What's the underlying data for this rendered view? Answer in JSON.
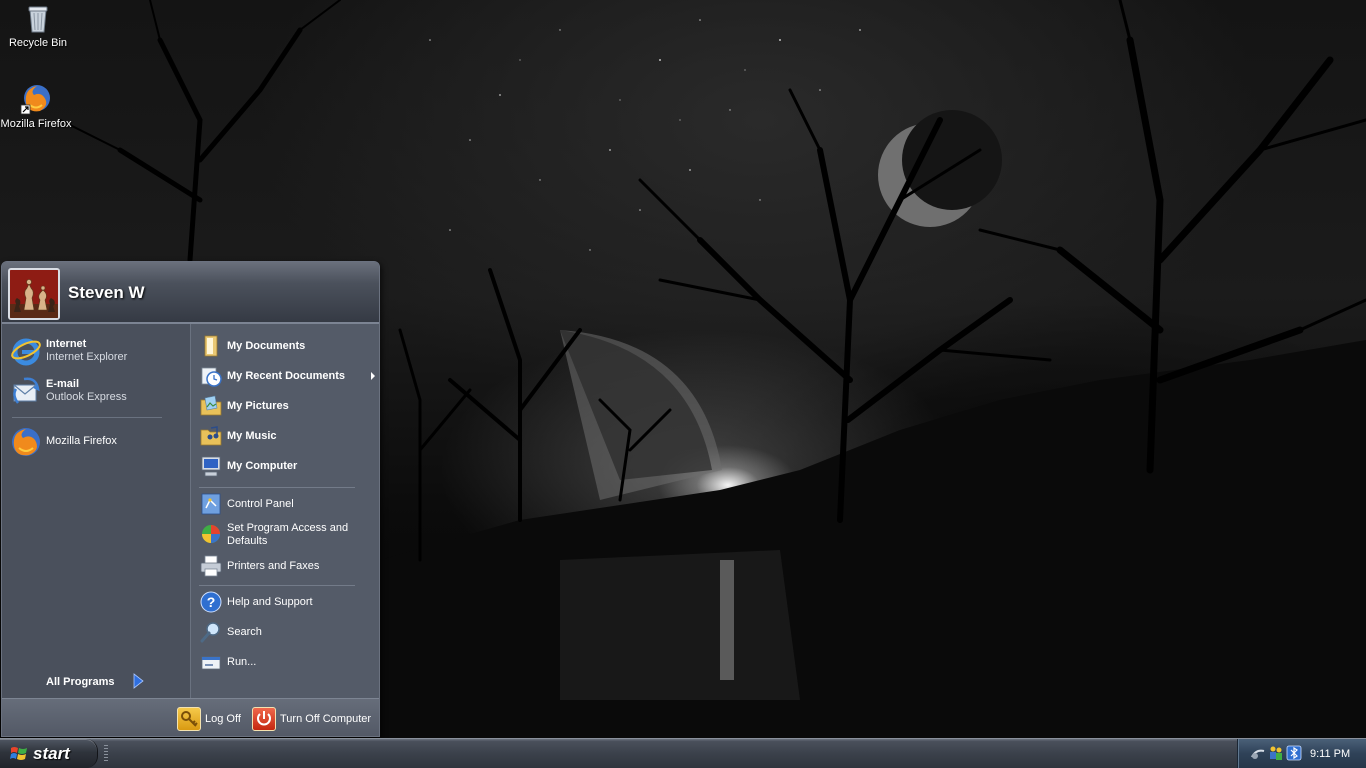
{
  "desktop": {
    "icons": [
      {
        "label": "Recycle Bin",
        "icon": "recycle-bin-icon"
      },
      {
        "label": "Mozilla Firefox",
        "icon": "firefox-icon"
      }
    ]
  },
  "start_menu": {
    "user": {
      "name": "Steven W",
      "avatar": "chess-pieces-avatar"
    },
    "pinned": [
      {
        "title": "Internet",
        "subtitle": "Internet Explorer",
        "icon": "internet-explorer-icon"
      },
      {
        "title": "E-mail",
        "subtitle": "Outlook Express",
        "icon": "outlook-express-icon"
      }
    ],
    "recent_programs": [
      {
        "label": "Mozilla Firefox",
        "icon": "firefox-icon"
      }
    ],
    "all_programs": "All Programs",
    "places": [
      {
        "label": "My Documents",
        "icon": "folder-documents-icon"
      },
      {
        "label": "My Recent Documents",
        "icon": "recent-documents-icon"
      },
      {
        "label": "My Pictures",
        "icon": "folder-pictures-icon"
      },
      {
        "label": "My Music",
        "icon": "folder-music-icon"
      },
      {
        "label": "My Computer",
        "icon": "computer-icon"
      }
    ],
    "system": [
      {
        "label": "Control Panel",
        "icon": "control-panel-icon"
      },
      {
        "label": "Set Program Access and Defaults",
        "icon": "program-access-icon"
      },
      {
        "label": "Printers and Faxes",
        "icon": "printer-icon"
      }
    ],
    "help": [
      {
        "label": "Help and Support",
        "icon": "help-icon"
      },
      {
        "label": "Search",
        "icon": "search-icon"
      },
      {
        "label": "Run...",
        "icon": "run-icon"
      }
    ],
    "footer": {
      "log_off": "Log Off",
      "turn_off": "Turn Off Computer"
    }
  },
  "taskbar": {
    "start_label": "start",
    "clock": "9:11 PM",
    "tray_icons": [
      "network-icon",
      "users-icon",
      "bluetooth-icon"
    ]
  },
  "colors": {
    "menu_body": "#4d5360",
    "menu_right_pane": "#545b68",
    "taskbar": "#3b414b",
    "tray": "#2f4258"
  }
}
